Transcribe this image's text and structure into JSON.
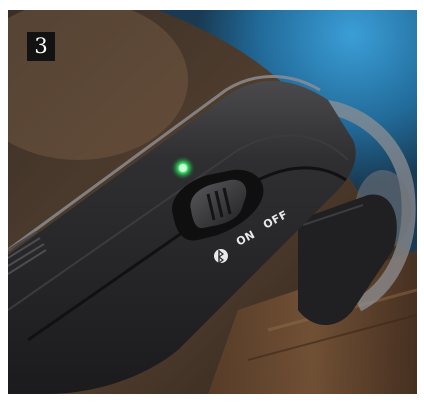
{
  "photo": {
    "step_number": "3",
    "switch_on_label": "ON",
    "switch_off_label": "OFF",
    "icons": [
      "bluetooth-icon",
      "status-led-icon"
    ],
    "colors": {
      "led": "#3ddc6a",
      "device_body": "#2b2b2d",
      "background_blue": "#2a86c0",
      "wood": "#6b4a32"
    }
  }
}
